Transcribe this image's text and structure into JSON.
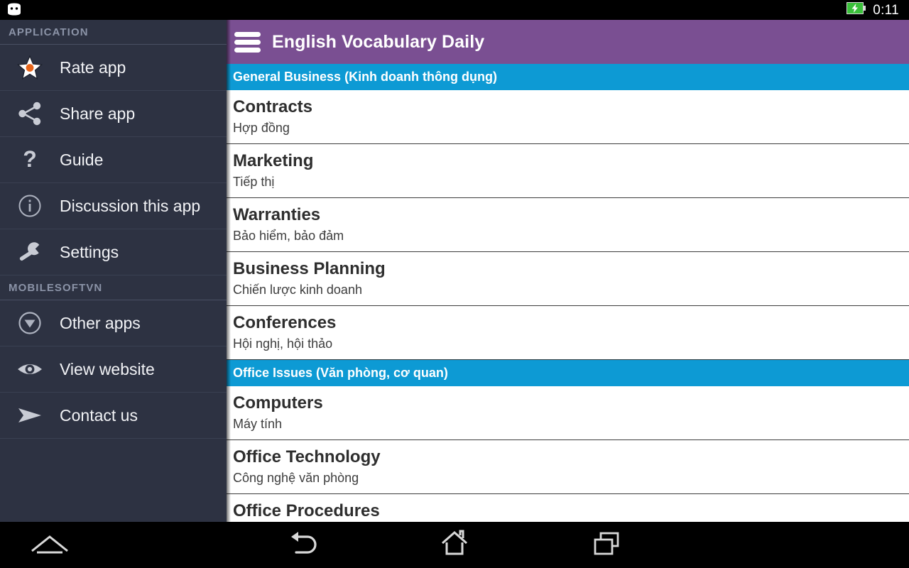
{
  "statusbar": {
    "android_icon": "android-head-icon",
    "battery_icon": "battery-charging-icon",
    "time": "0:11"
  },
  "drawer": {
    "sections": [
      {
        "label": "APPLICATION",
        "items": [
          {
            "icon": "star-icon",
            "label": "Rate app"
          },
          {
            "icon": "share-icon",
            "label": "Share app"
          },
          {
            "icon": "question-mark-icon",
            "label": "Guide"
          },
          {
            "icon": "info-circle-icon",
            "label": "Discussion this app"
          },
          {
            "icon": "wrench-icon",
            "label": "Settings"
          }
        ]
      },
      {
        "label": "MOBILESOFTVN",
        "items": [
          {
            "icon": "download-circle-icon",
            "label": "Other apps"
          },
          {
            "icon": "eye-icon",
            "label": "View website"
          },
          {
            "icon": "send-arrow-icon",
            "label": "Contact us"
          }
        ]
      }
    ]
  },
  "appbar": {
    "menu_icon": "hamburger-menu-icon",
    "title": "English Vocabulary Daily"
  },
  "list": {
    "groups": [
      {
        "header": "General Business (Kinh doanh thông dụng)",
        "rows": [
          {
            "term": "Contracts",
            "translation": "Hợp đồng"
          },
          {
            "term": "Marketing",
            "translation": "Tiếp thị"
          },
          {
            "term": "Warranties",
            "translation": "Bảo hiểm, bảo đảm"
          },
          {
            "term": "Business Planning",
            "translation": "Chiến lược kinh doanh"
          },
          {
            "term": "Conferences",
            "translation": "Hội nghị, hội thảo"
          }
        ]
      },
      {
        "header": "Office Issues (Văn phòng, cơ quan)",
        "rows": [
          {
            "term": "Computers",
            "translation": "Máy tính"
          },
          {
            "term": "Office Technology",
            "translation": "Công nghệ văn phòng"
          },
          {
            "term": "Office Procedures",
            "translation": ""
          }
        ]
      }
    ]
  },
  "navbar": {
    "buttons": [
      {
        "icon": "menu-chevron-icon",
        "name": "nav-menu"
      },
      {
        "icon": "back-arrow-icon",
        "name": "nav-back"
      },
      {
        "icon": "home-icon",
        "name": "nav-home"
      },
      {
        "icon": "recent-apps-icon",
        "name": "nav-recents"
      }
    ]
  },
  "colors": {
    "appbar_purple": "#7a4f92",
    "section_cyan": "#0d9ad4",
    "drawer_bg": "#2d3242",
    "accent_orange": "#e8651a",
    "battery_green": "#3ac03a"
  }
}
